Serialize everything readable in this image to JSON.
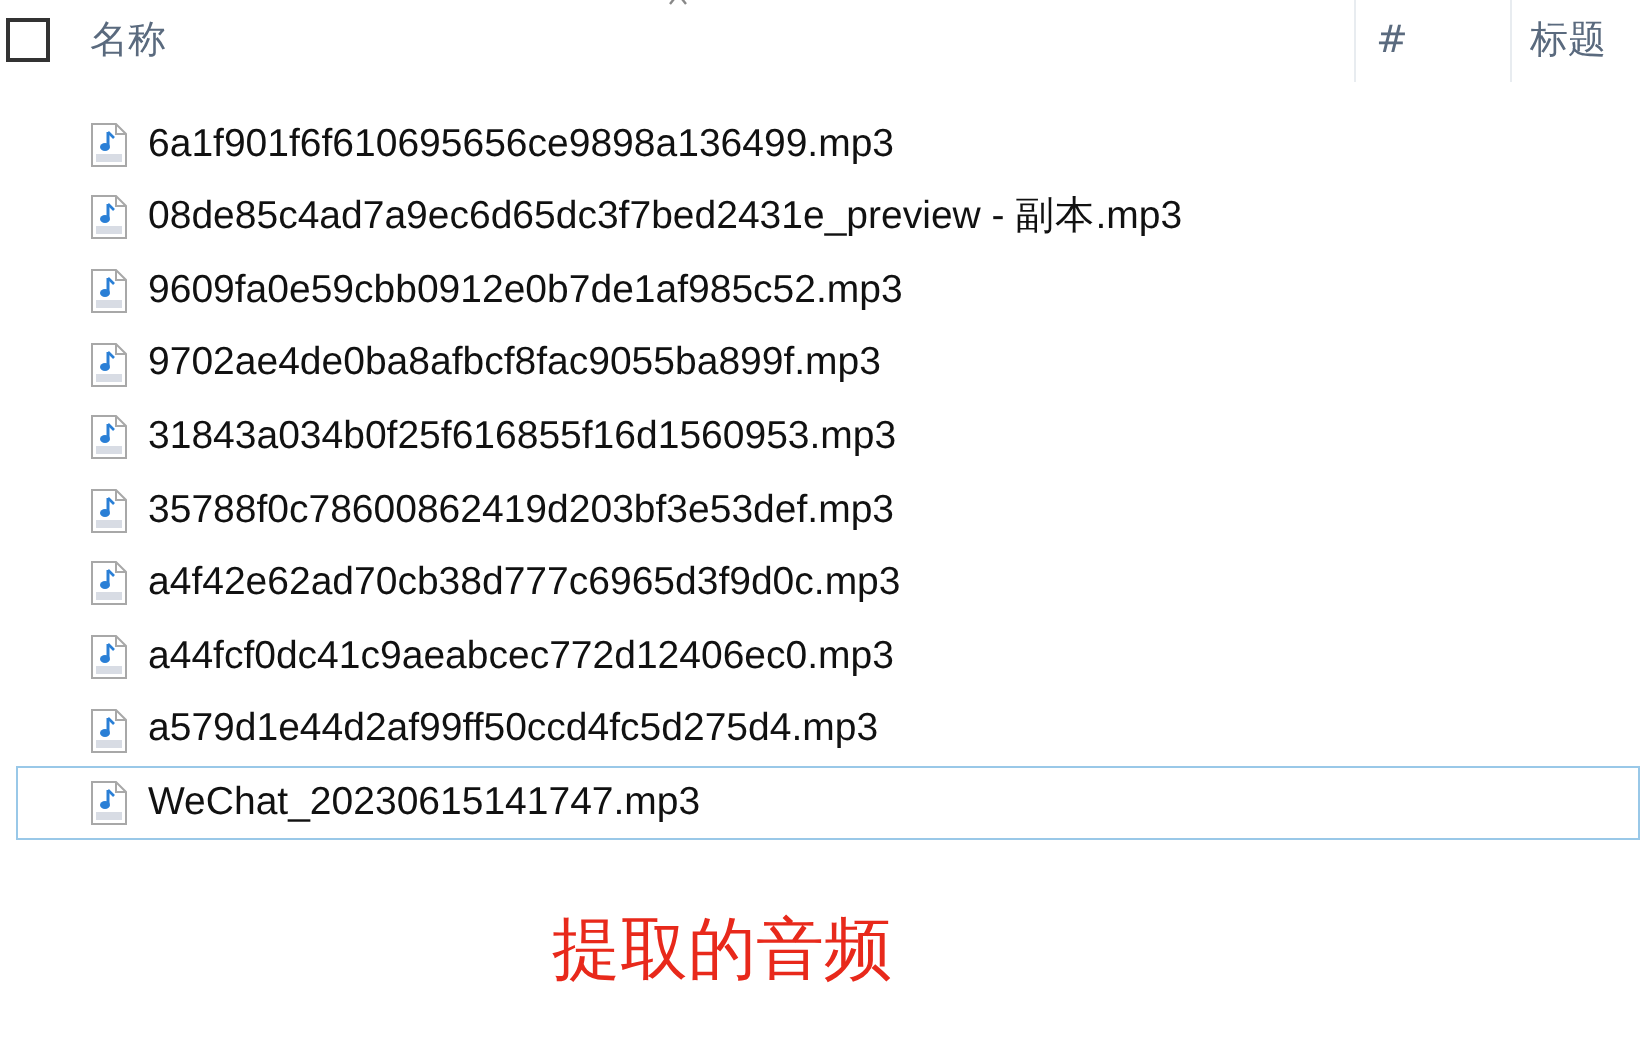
{
  "header": {
    "select_all_checked": false,
    "columns": [
      {
        "label": "名称"
      },
      {
        "label": "#"
      },
      {
        "label": "标题"
      }
    ]
  },
  "files": [
    {
      "name": "6a1f901f6f610695656ce9898a136499.mp3",
      "focused": false
    },
    {
      "name": "08de85c4ad7a9ec6d65dc3f7bed2431e_preview - 副本.mp3",
      "focused": false
    },
    {
      "name": "9609fa0e59cbb0912e0b7de1af985c52.mp3",
      "focused": false
    },
    {
      "name": "9702ae4de0ba8afbcf8fac9055ba899f.mp3",
      "focused": false
    },
    {
      "name": "31843a034b0f25f616855f16d1560953.mp3",
      "focused": false
    },
    {
      "name": "35788f0c78600862419d203bf3e53def.mp3",
      "focused": false
    },
    {
      "name": "a4f42e62ad70cb38d777c6965d3f9d0c.mp3",
      "focused": false
    },
    {
      "name": "a44fcf0dc41c9aeabcec772d12406ec0.mp3",
      "focused": false
    },
    {
      "name": "a579d1e44d2af99ff50ccd4fc5d275d4.mp3",
      "focused": false
    },
    {
      "name": "WeChat_20230615141747.mp3",
      "focused": true
    }
  ],
  "caption": "提取的音频"
}
